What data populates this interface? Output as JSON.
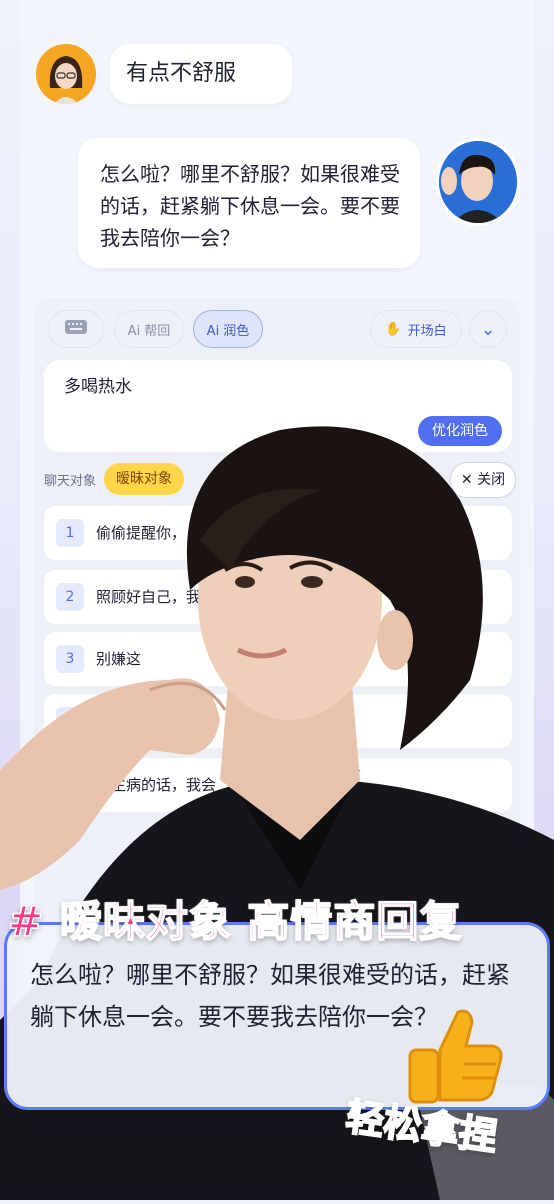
{
  "chat": {
    "incoming_message": "有点不舒服",
    "outgoing_message": "怎么啦？哪里不舒服？如果很难受的话，赶紧躺下休息一会。要不要我去陪你一会？"
  },
  "toolbar": {
    "keyboard_icon": "keyboard-icon",
    "ai_reply": "Ai 帮回",
    "ai_polish": "Ai 润色",
    "opener": "开场白",
    "collapse_icon": "chevron-down-icon"
  },
  "input": {
    "value": "多喝热水",
    "optimize_button": "优化润色"
  },
  "target": {
    "label": "聊天对象",
    "selected": "暧昧对象",
    "close_label": "关闭"
  },
  "suggestions": [
    {
      "num": "1",
      "text": "偷偷提醒你，"
    },
    {
      "num": "2",
      "text": "照顾好自己，我"
    },
    {
      "num": "3",
      "text": "别嫌这"
    },
    {
      "num": "4",
      "text": ""
    },
    {
      "num": "5",
      "text": "你生病的话，我会"
    }
  ],
  "promo": {
    "headline": "# 暧昧对象  高情商回复",
    "quote": "怎么啦？哪里不舒服？如果很难受的话，赶紧躺下休息一会。要不要我去陪你一会？",
    "tagline": "轻松拿捏"
  },
  "colors": {
    "accent": "#4f6ff0",
    "tag": "#ffd54a",
    "pink": "#ff3a8a"
  }
}
